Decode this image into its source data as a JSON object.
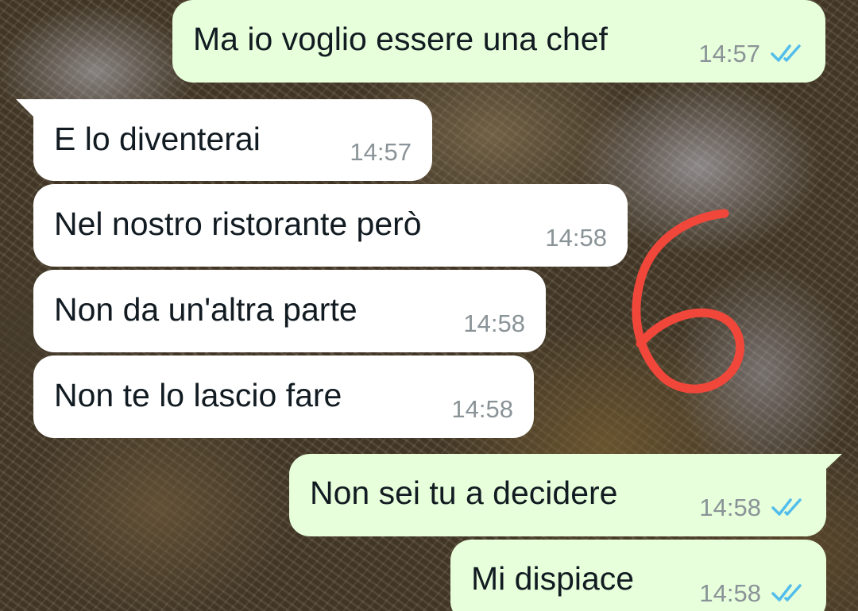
{
  "messages": [
    {
      "text": "Ma io voglio essere una chef",
      "time": "14:57",
      "direction": "outgoing",
      "status": "read"
    },
    {
      "text": "E lo diventerai",
      "time": "14:57",
      "direction": "incoming"
    },
    {
      "text": "Nel nostro ristorante però",
      "time": "14:58",
      "direction": "incoming"
    },
    {
      "text": "Non da un'altra parte",
      "time": "14:58",
      "direction": "incoming"
    },
    {
      "text": "Non te lo lascio fare",
      "time": "14:58",
      "direction": "incoming"
    },
    {
      "text": "Non sei tu a decidere",
      "time": "14:58",
      "direction": "outgoing",
      "status": "read"
    },
    {
      "text": "Mi dispiace",
      "time": "14:58",
      "direction": "outgoing",
      "status": "read"
    }
  ],
  "icons": {
    "read_receipt": "double-check-icon",
    "annotation": "handwritten-six-mark"
  },
  "colors": {
    "incoming_bubble": "#ffffff",
    "outgoing_bubble": "#e7ffdb",
    "timestamp": "#8a9397",
    "read_tick": "#53bdeb",
    "annotation_red": "#f0473a"
  }
}
